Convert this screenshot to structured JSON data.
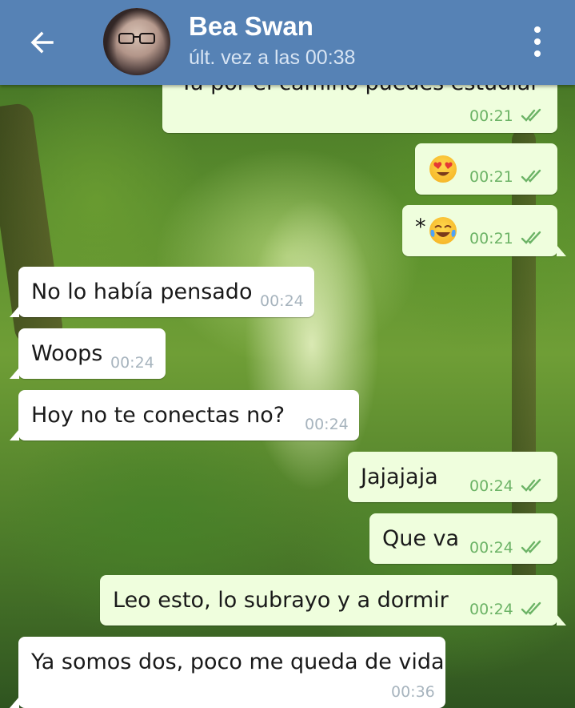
{
  "header": {
    "back_icon": "arrow-left-icon",
    "contact_name": "Bea Swan",
    "last_seen": "últ. vez a las 00:38",
    "menu_icon": "more-vert-icon",
    "color": "#5682b5"
  },
  "messages": [
    {
      "direction": "out",
      "text": "Tú por el camino puedes estudiar",
      "time": "00:21",
      "status": "read"
    },
    {
      "direction": "out",
      "text": "",
      "emoji": "heart-eyes-emoji",
      "time": "00:21",
      "status": "read"
    },
    {
      "direction": "out",
      "text": "*",
      "emoji": "tears-of-joy-emoji",
      "time": "00:21",
      "status": "read"
    },
    {
      "direction": "in",
      "text": "No lo había pensado",
      "time": "00:24"
    },
    {
      "direction": "in",
      "text": "Woops",
      "time": "00:24"
    },
    {
      "direction": "in",
      "text": "Hoy no te conectas no?",
      "time": "00:24"
    },
    {
      "direction": "out",
      "text": "Jajajaja",
      "time": "00:24",
      "status": "read"
    },
    {
      "direction": "out",
      "text": "Que va",
      "time": "00:24",
      "status": "read"
    },
    {
      "direction": "out",
      "text": "Leo esto, lo subrayo y a dormir",
      "time": "00:24",
      "status": "read"
    },
    {
      "direction": "in",
      "text": "Ya somos dos, poco me queda de vida",
      "time": "00:36"
    }
  ],
  "colors": {
    "outgoing_bubble": "#effedd",
    "incoming_bubble": "#ffffff",
    "read_ticks": "#6cb366"
  }
}
